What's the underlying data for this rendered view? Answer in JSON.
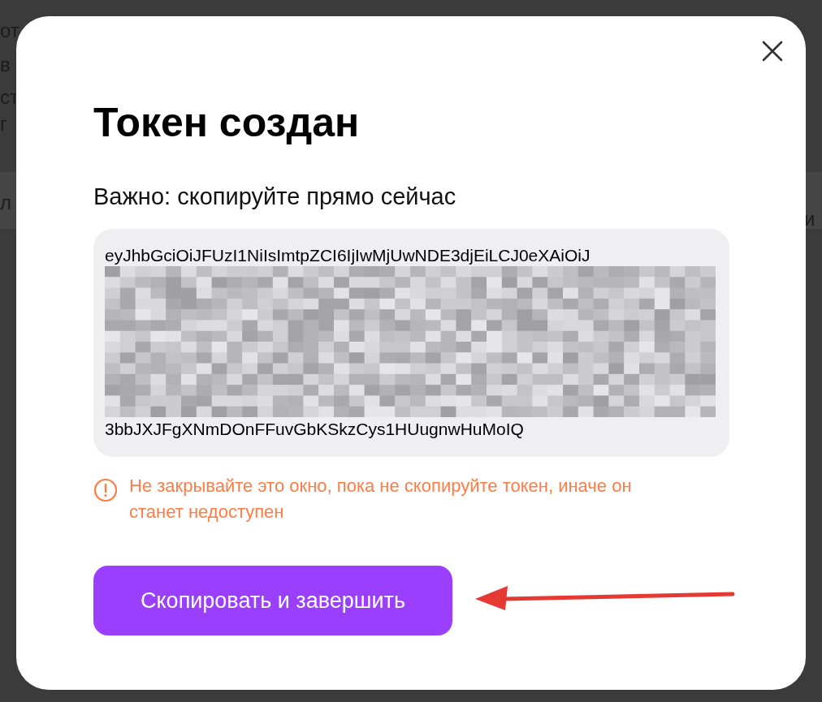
{
  "background": {
    "left_fragments": [
      "от",
      "в",
      "ст",
      "г",
      "л"
    ],
    "right_fragment": "и"
  },
  "dialog": {
    "title": "Токен создан",
    "subtitle": "Важно: скопируйте прямо сейчас",
    "token": {
      "first_line": "eyJhbGciOiJFUzI1NiIsImtpZCI6IjIwMjUwNDE3djEiLCJ0eXAiOiJ",
      "last_line": "3bbJXJFgXNmDOnFFuvGbKSkzCys1HUugnwHuMoIQ"
    },
    "warning": "Не закрывайте это окно, пока не скопируйте токен, иначе он станет недоступен",
    "button": "Скопировать и завершить"
  }
}
